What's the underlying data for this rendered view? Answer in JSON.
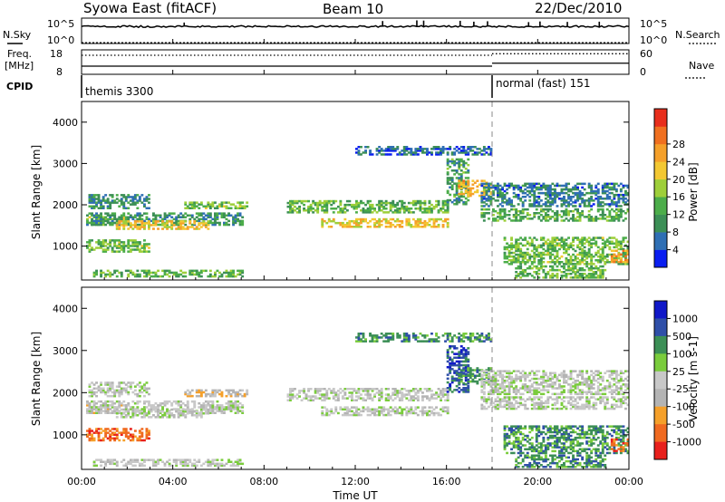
{
  "header": {
    "title": "Syowa East (fitACF)",
    "beam": "Beam 10",
    "date": "22/Dec/2010"
  },
  "noise_panel": {
    "left_label": "N.Sky",
    "left_top_tick": "10^5",
    "left_bottom_tick": "10^0",
    "right_top_tick": "10^5",
    "right_bottom_tick": "10^0",
    "right_label": "N.Search"
  },
  "freq_panel": {
    "left_label_line1": "Freq.",
    "left_label_line2": "[MHz]",
    "left_top_tick": "18",
    "left_bottom_tick": "8",
    "right_top_tick": "60",
    "right_bottom_tick": "0",
    "right_label": "Nave"
  },
  "cpid_panel": {
    "label": "CPID",
    "mode1": "themis 3300",
    "mode2": "normal (fast) 151"
  },
  "colors": {
    "power_scale": [
      "#0a1ef0",
      "#2f6fb4",
      "#3c8f56",
      "#4cad4a",
      "#9ecf3a",
      "#f3c832",
      "#f5a02a",
      "#f07020",
      "#e82e1c"
    ],
    "velocity_scale": [
      "#e8201c",
      "#f06a20",
      "#f5a02a",
      "#b4b4b4",
      "#c8c8c8",
      "#7acc3c",
      "#3c8f56",
      "#2f4fa8",
      "#1018c8"
    ]
  },
  "chart_data": [
    {
      "type": "heatmap",
      "name": "power",
      "xlabel": "",
      "ylabel": "Slant Range [km]",
      "x_ticks": [
        "00:00",
        "04:00",
        "08:00",
        "12:00",
        "16:00",
        "20:00",
        "00:00"
      ],
      "y_ticks": [
        1000,
        2000,
        3000,
        4000
      ],
      "xlim_hours": [
        0,
        24
      ],
      "ylim_km": [
        180,
        4500
      ],
      "colorbar_label": "Power [dB]",
      "colorbar_ticks": [
        4,
        8,
        12,
        16,
        20,
        24,
        28
      ],
      "regions": [
        {
          "t": [
            0.2,
            2.0
          ],
          "r": [
            1500,
            1700
          ],
          "v": 13,
          "vel": 3
        },
        {
          "t": [
            0.2,
            7.0
          ],
          "r": [
            1500,
            1800
          ],
          "v": 9,
          "vel": 4
        },
        {
          "t": [
            1.5,
            5.5
          ],
          "r": [
            1400,
            1600
          ],
          "v": 19,
          "vel": 4
        },
        {
          "t": [
            0.2,
            3.0
          ],
          "r": [
            850,
            1150
          ],
          "v": 13,
          "vel": 1
        },
        {
          "t": [
            0.3,
            3.0
          ],
          "r": [
            1900,
            2250
          ],
          "v": 8,
          "vel": 4
        },
        {
          "t": [
            4.5,
            7.2
          ],
          "r": [
            1900,
            2050
          ],
          "v": 13,
          "vel": 3
        },
        {
          "t": [
            0.5,
            7.0
          ],
          "r": [
            250,
            400
          ],
          "v": 12,
          "vel": 4
        },
        {
          "t": [
            9.0,
            16.0
          ],
          "r": [
            1800,
            2100
          ],
          "v": 12,
          "vel": 4
        },
        {
          "t": [
            10.5,
            16.0
          ],
          "r": [
            1450,
            1650
          ],
          "v": 19,
          "vel": 4
        },
        {
          "t": [
            12.0,
            18.0
          ],
          "r": [
            3200,
            3400
          ],
          "v": 6,
          "vel": 6
        },
        {
          "t": [
            16.0,
            17.0
          ],
          "r": [
            2000,
            3100
          ],
          "v": 10,
          "vel": 7
        },
        {
          "t": [
            16.5,
            18.0
          ],
          "r": [
            2200,
            2600
          ],
          "v": 20,
          "vel": 6
        },
        {
          "t": [
            17.5,
            24.0
          ],
          "r": [
            1600,
            1900
          ],
          "v": 11,
          "vel": 4
        },
        {
          "t": [
            17.5,
            24.0
          ],
          "r": [
            1950,
            2500
          ],
          "v": 7,
          "vel": 4
        },
        {
          "t": [
            18.5,
            24.0
          ],
          "r": [
            550,
            1200
          ],
          "v": 13,
          "vel": 6
        },
        {
          "t": [
            19.0,
            23.0
          ],
          "r": [
            220,
            500
          ],
          "v": 12,
          "vel": 6
        },
        {
          "t": [
            23.2,
            24.0
          ],
          "r": [
            600,
            900
          ],
          "v": 22,
          "vel": 1
        }
      ]
    },
    {
      "type": "heatmap",
      "name": "velocity",
      "xlabel": "Time UT",
      "ylabel": "Slant Range [km]",
      "x_ticks": [
        "00:00",
        "04:00",
        "08:00",
        "12:00",
        "16:00",
        "20:00",
        "00:00"
      ],
      "y_ticks": [
        1000,
        2000,
        3000,
        4000
      ],
      "xlim_hours": [
        0,
        24
      ],
      "ylim_km": [
        180,
        4500
      ],
      "colorbar_label": "Velocity [m s-1]",
      "colorbar_ticks": [
        1000,
        500,
        100,
        25,
        -25,
        -100,
        -500,
        -1000
      ]
    }
  ],
  "noise_series": {
    "baseline_pct": 70,
    "spike_hours": [
      4.5,
      13.2,
      14.7,
      15.0,
      16.6,
      17.2,
      17.8,
      19.6,
      20.1,
      21.3,
      22.7
    ],
    "spike_pct": [
      88,
      95,
      98,
      97,
      96,
      92,
      94,
      90,
      93,
      91,
      92
    ]
  },
  "freq_series": {
    "segments": [
      {
        "t": [
          0,
          18
        ],
        "mhz": 11.2
      },
      {
        "t": [
          18,
          24
        ],
        "mhz": 12.5
      }
    ],
    "nave_segments": [
      {
        "t": [
          0,
          18
        ],
        "n": 48
      },
      {
        "t": [
          18,
          24
        ],
        "n": 52
      }
    ]
  },
  "cpid_change_hour": 18.0
}
